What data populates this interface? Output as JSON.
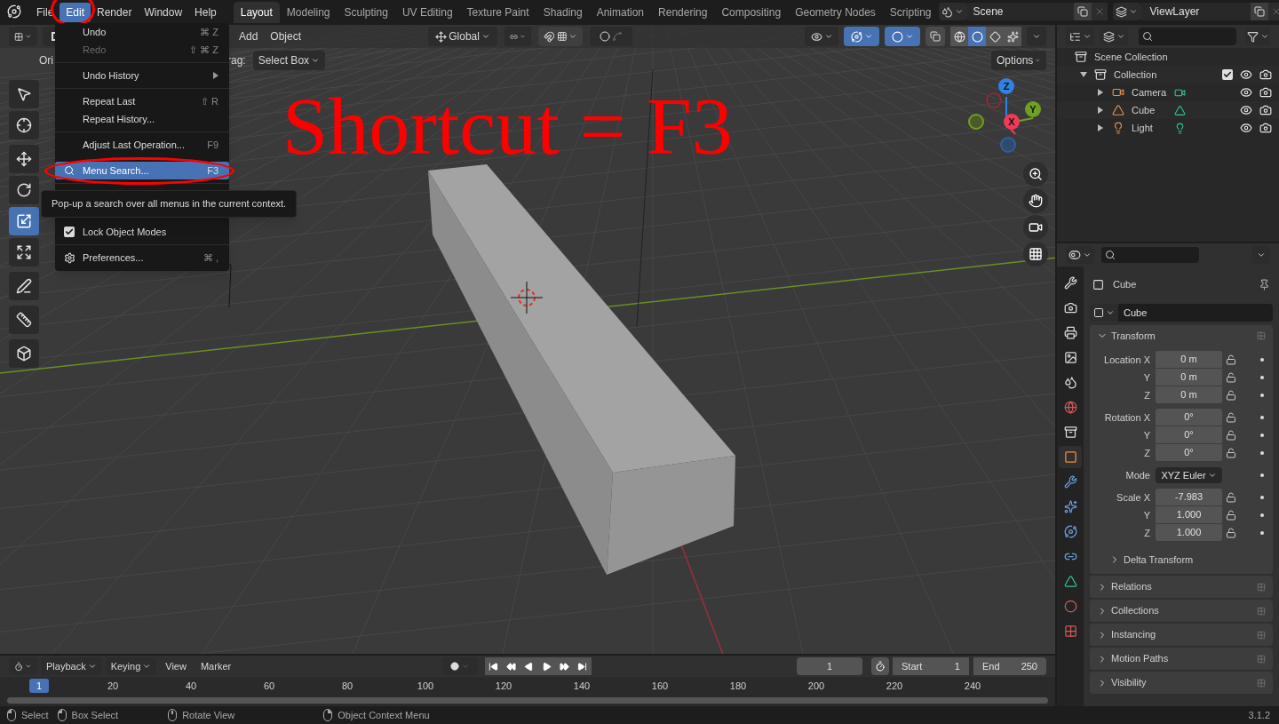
{
  "menubar": [
    {
      "label": "File",
      "selected": false,
      "circled": false
    },
    {
      "label": "Edit",
      "selected": true,
      "circled": true
    },
    {
      "label": "Render",
      "selected": false,
      "circled": false
    },
    {
      "label": "Window",
      "selected": false,
      "circled": false
    },
    {
      "label": "Help",
      "selected": false,
      "circled": false
    }
  ],
  "workspaces": [
    {
      "label": "Layout",
      "selected": true
    },
    {
      "label": "Modeling",
      "selected": false
    },
    {
      "label": "Sculpting",
      "selected": false
    },
    {
      "label": "UV Editing",
      "selected": false
    },
    {
      "label": "Texture Paint",
      "selected": false
    },
    {
      "label": "Shading",
      "selected": false
    },
    {
      "label": "Animation",
      "selected": false
    },
    {
      "label": "Rendering",
      "selected": false
    },
    {
      "label": "Compositing",
      "selected": false
    },
    {
      "label": "Geometry Nodes",
      "selected": false
    },
    {
      "label": "Scripting",
      "selected": false
    }
  ],
  "scene": "Scene",
  "view_layer": "ViewLayer",
  "viewport": {
    "header_menus": [
      "Add",
      "Object"
    ],
    "orientation": "Global",
    "orientation_label": "Ori",
    "drag_label": "rag:",
    "drag_value": "Select Box",
    "options": "Options",
    "gizmo_on": true,
    "overlays_on": true,
    "shading": [
      {
        "kind": "wireframe",
        "selected": false
      },
      {
        "kind": "solid",
        "selected": true
      },
      {
        "kind": "material",
        "selected": false
      },
      {
        "kind": "rendered",
        "selected": false
      }
    ],
    "tools": [
      [
        {
          "kind": "select",
          "selected": false
        },
        {
          "kind": "cursor",
          "selected": false
        }
      ],
      [
        {
          "kind": "move",
          "selected": false
        },
        {
          "kind": "rotate",
          "selected": false
        },
        {
          "kind": "scale",
          "selected": true
        },
        {
          "kind": "transform",
          "selected": false
        }
      ],
      [
        {
          "kind": "annotate",
          "selected": false
        }
      ],
      [
        {
          "kind": "measure",
          "selected": false
        }
      ],
      [
        {
          "kind": "add_cube",
          "selected": false
        }
      ]
    ],
    "axes": [
      "Z",
      "Y",
      "X"
    ]
  },
  "annotation": "Shortcut = F3",
  "edit_menu": [
    {
      "kind": "item",
      "label": "Undo",
      "shortcut": "⌘ Z",
      "disabled": false,
      "selected": false,
      "circled": false
    },
    {
      "kind": "item",
      "label": "Redo",
      "shortcut": "⇧ ⌘ Z",
      "disabled": true,
      "selected": false,
      "circled": false
    },
    {
      "kind": "separator"
    },
    {
      "kind": "submenu",
      "label": "Undo History",
      "disabled": false,
      "selected": false,
      "circled": false
    },
    {
      "kind": "separator"
    },
    {
      "kind": "item",
      "label": "Repeat Last",
      "shortcut": "⇧ R",
      "disabled": false,
      "selected": false,
      "circled": false
    },
    {
      "kind": "item",
      "label": "Repeat History...",
      "disabled": false,
      "selected": false,
      "circled": false
    },
    {
      "kind": "separator"
    },
    {
      "kind": "item",
      "label": "Adjust Last Operation...",
      "shortcut": "F9",
      "disabled": false,
      "selected": false,
      "circled": false
    },
    {
      "kind": "search",
      "label": "Menu Search...",
      "shortcut": "F3",
      "disabled": false,
      "selected": true,
      "circled": true,
      "tooltip": "Pop-up a search over all menus in the current context."
    },
    {
      "kind": "separator"
    },
    {
      "kind": "checkbox",
      "label": "Lock Object Modes",
      "checked": true,
      "disabled": false,
      "selected": false,
      "circled": false
    },
    {
      "kind": "separator"
    },
    {
      "kind": "settings",
      "label": "Preferences...",
      "shortcut": "⌘ ,",
      "disabled": false,
      "selected": false,
      "circled": false
    }
  ],
  "outliner": {
    "root": "Scene Collection",
    "items": [
      {
        "label": "Collection",
        "expanded": true,
        "checked": true,
        "children": [
          {
            "label": "Camera",
            "kind": "camera",
            "expanded": false
          },
          {
            "label": "Cube",
            "kind": "mesh",
            "expanded": false
          },
          {
            "label": "Light",
            "kind": "light",
            "expanded": false
          }
        ]
      }
    ]
  },
  "properties": {
    "tabs": [
      {
        "kind": "tool",
        "selected": false
      },
      {
        "kind": "render",
        "selected": false
      },
      {
        "kind": "output",
        "selected": false
      },
      {
        "kind": "view_layer",
        "selected": false
      },
      {
        "kind": "scene",
        "selected": false
      },
      {
        "kind": "world",
        "selected": false
      },
      {
        "kind": "collection",
        "selected": false
      },
      {
        "kind": "object",
        "selected": true
      },
      {
        "kind": "modifiers",
        "selected": false
      },
      {
        "kind": "particles",
        "selected": false
      },
      {
        "kind": "physics",
        "selected": false
      },
      {
        "kind": "constraints",
        "selected": false
      },
      {
        "kind": "data",
        "selected": false
      },
      {
        "kind": "material",
        "selected": false
      },
      {
        "kind": "texture",
        "selected": false
      }
    ],
    "object": "Cube",
    "datablock": "Cube",
    "transform": {
      "title": "Transform",
      "expanded": true,
      "groups": [
        [
          {
            "kind": "number",
            "label": "Location X",
            "value": "0 m"
          },
          {
            "kind": "number",
            "label": "Y",
            "value": "0 m"
          },
          {
            "kind": "number",
            "label": "Z",
            "value": "0 m"
          }
        ],
        [
          {
            "kind": "number",
            "label": "Rotation X",
            "value": "0°"
          },
          {
            "kind": "number",
            "label": "Y",
            "value": "0°"
          },
          {
            "kind": "number",
            "label": "Z",
            "value": "0°"
          }
        ],
        [
          {
            "kind": "select",
            "label": "Mode",
            "value": "XYZ Euler"
          }
        ],
        [
          {
            "kind": "number",
            "label": "Scale X",
            "value": "-7.983"
          },
          {
            "kind": "number",
            "label": "Y",
            "value": "1.000"
          },
          {
            "kind": "number",
            "label": "Z",
            "value": "1.000"
          }
        ]
      ],
      "subpanel": {
        "title": "Delta Transform",
        "expanded": false
      }
    },
    "panels": [
      {
        "title": "Relations",
        "expanded": false
      },
      {
        "title": "Collections",
        "expanded": false
      },
      {
        "title": "Instancing",
        "expanded": false
      },
      {
        "title": "Motion Paths",
        "expanded": false
      },
      {
        "title": "Visibility",
        "expanded": false
      }
    ]
  },
  "timeline": {
    "menus": [
      {
        "label": "Playback",
        "dropdown": true
      },
      {
        "label": "Keying",
        "dropdown": true
      },
      {
        "label": "View",
        "dropdown": false
      },
      {
        "label": "Marker",
        "dropdown": false
      }
    ],
    "current_frame": "1",
    "start_label": "Start",
    "start": "1",
    "end_label": "End",
    "end": "250",
    "ruler_current": "1",
    "ruler": [
      "20",
      "40",
      "60",
      "80",
      "100",
      "120",
      "140",
      "160",
      "180",
      "200",
      "220",
      "240"
    ]
  },
  "status_bar": {
    "hints": [
      {
        "kind": "left",
        "label": "Select"
      },
      {
        "kind": "left",
        "label": "Box Select"
      },
      {
        "kind": "middle",
        "label": "Rotate View"
      },
      {
        "kind": "right",
        "label": "Object Context Menu"
      }
    ],
    "version": "3.1.2"
  }
}
